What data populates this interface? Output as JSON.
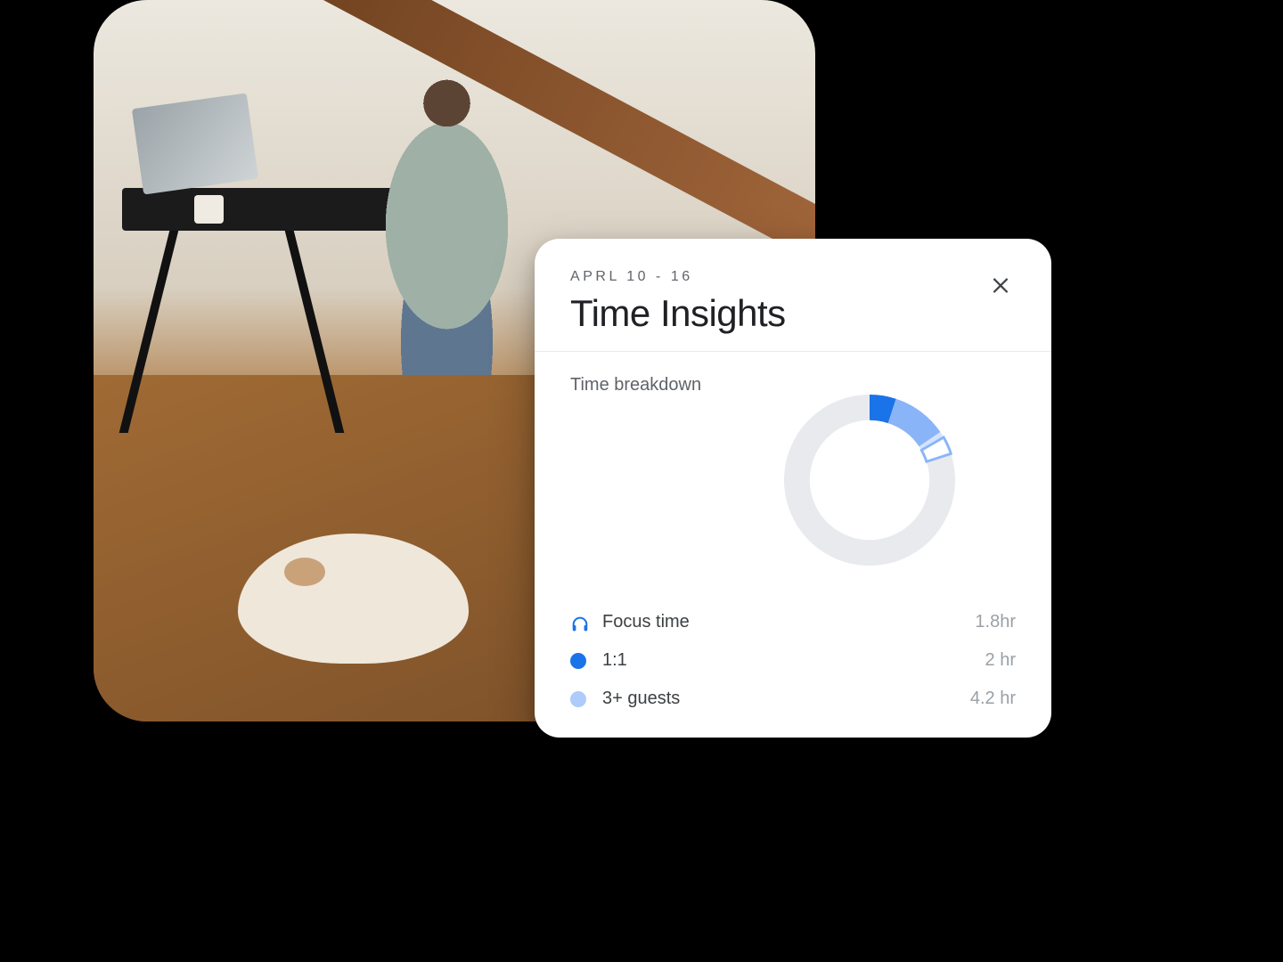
{
  "card": {
    "date_range": "APRL 10 - 16",
    "title": "Time Insights",
    "section_label": "Time breakdown"
  },
  "legend": [
    {
      "icon": "headphones-icon",
      "label": "Focus time",
      "value": "1.8hr",
      "color": "#1a73e8"
    },
    {
      "icon": "circle",
      "label": "1:1",
      "value": "2 hr",
      "color": "#1a73e8"
    },
    {
      "icon": "circle",
      "label": "3+ guests",
      "value": "4.2 hr",
      "color": "#aecbfa"
    }
  ],
  "chart_data": {
    "type": "pie",
    "title": "Time breakdown",
    "series": [
      {
        "name": "1:1",
        "value": 2.0,
        "color": "#1a73e8"
      },
      {
        "name": "3+ guests",
        "value": 4.2,
        "color": "#8ab4f8"
      },
      {
        "name": "Focus time",
        "value": 1.8,
        "color": "#d2e3fc"
      },
      {
        "name": "Unallocated",
        "value": 32.0,
        "color": "#e8eaed"
      }
    ],
    "total_hours": 40,
    "note": "Donut chart; remaining grey segment represents unallocated time in the week"
  },
  "colors": {
    "text_primary": "#202124",
    "text_secondary": "#5f6368",
    "text_muted": "#9aa0a6",
    "divider": "#e8eaed"
  }
}
